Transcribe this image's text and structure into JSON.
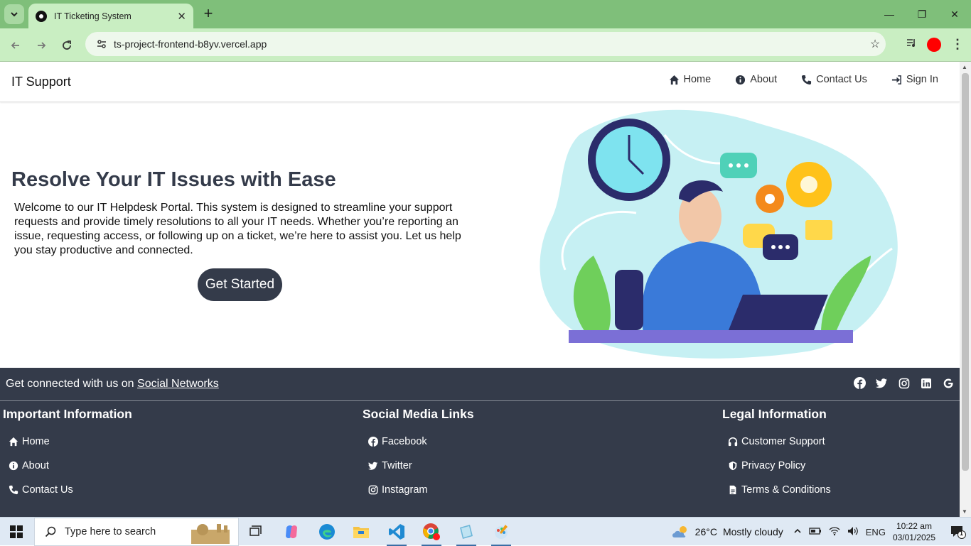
{
  "browser": {
    "tab_title": "IT Ticketing System",
    "url": "ts-project-frontend-b8yv.vercel.app"
  },
  "navbar": {
    "brand": "IT Support",
    "links": [
      "Home",
      "About",
      "Contact Us",
      "Sign In"
    ]
  },
  "hero": {
    "title": "Resolve Your IT Issues with Ease",
    "text": "Welcome to our IT Helpdesk Portal. This system is designed to streamline your support requests and provide timely resolutions to all your IT needs. Whether you’re reporting an issue, requesting access, or following up on a ticket, we’re here to assist you. Let us help you stay productive and connected.",
    "cta": "Get Started"
  },
  "footer": {
    "social_lead": "Get connected with us on",
    "social_link": "Social Networks",
    "columns": [
      {
        "title": "Important Information",
        "items": [
          "Home",
          "About",
          "Contact Us"
        ]
      },
      {
        "title": "Social Media Links",
        "items": [
          "Facebook",
          "Twitter",
          "Instagram"
        ]
      },
      {
        "title": "Legal Information",
        "items": [
          "Customer Support",
          "Privacy Policy",
          "Terms & Conditions"
        ]
      }
    ]
  },
  "taskbar": {
    "search_placeholder": "Type here to search",
    "weather_temp": "26°C",
    "weather_desc": "Mostly cloudy",
    "language": "ENG",
    "time": "10:22 am",
    "date": "03/01/2025",
    "notification_count": "1"
  },
  "colors": {
    "primary_dark": "#343b4a",
    "tab_bar": "#7fbf7a",
    "toolbar": "#c9eec2"
  }
}
